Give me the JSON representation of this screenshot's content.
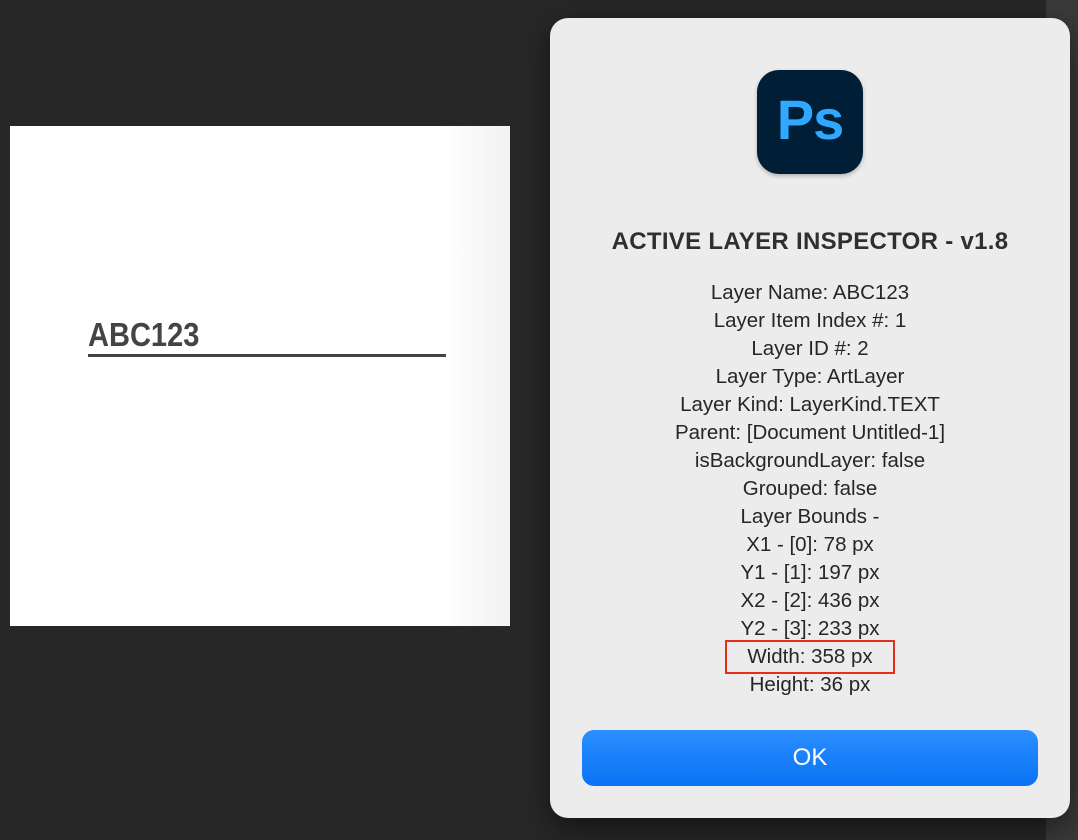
{
  "canvas": {
    "text": "ABC123"
  },
  "dialog": {
    "app_icon_label": "Ps",
    "title": "ACTIVE LAYER INSPECTOR - v1.8",
    "lines": [
      "Layer Name: ABC123",
      "Layer Item Index #: 1",
      "Layer ID #: 2",
      "Layer Type: ArtLayer",
      "Layer Kind: LayerKind.TEXT",
      "Parent: [Document Untitled-1]",
      "isBackgroundLayer: false",
      "Grouped: false",
      "Layer Bounds -",
      "X1 - [0]: 78 px",
      "Y1 - [1]: 197 px",
      "X2 - [2]: 436 px",
      "Y2 - [3]: 233 px",
      "Width: 358 px",
      "Height: 36 px"
    ],
    "ok_label": "OK"
  },
  "colors": {
    "background": "#272727",
    "dialog": "#ececec",
    "accent": "#0a72f5",
    "highlight_box": "#e4301b",
    "ps_icon_bg": "#001e36",
    "ps_icon_text": "#31a8ff"
  }
}
